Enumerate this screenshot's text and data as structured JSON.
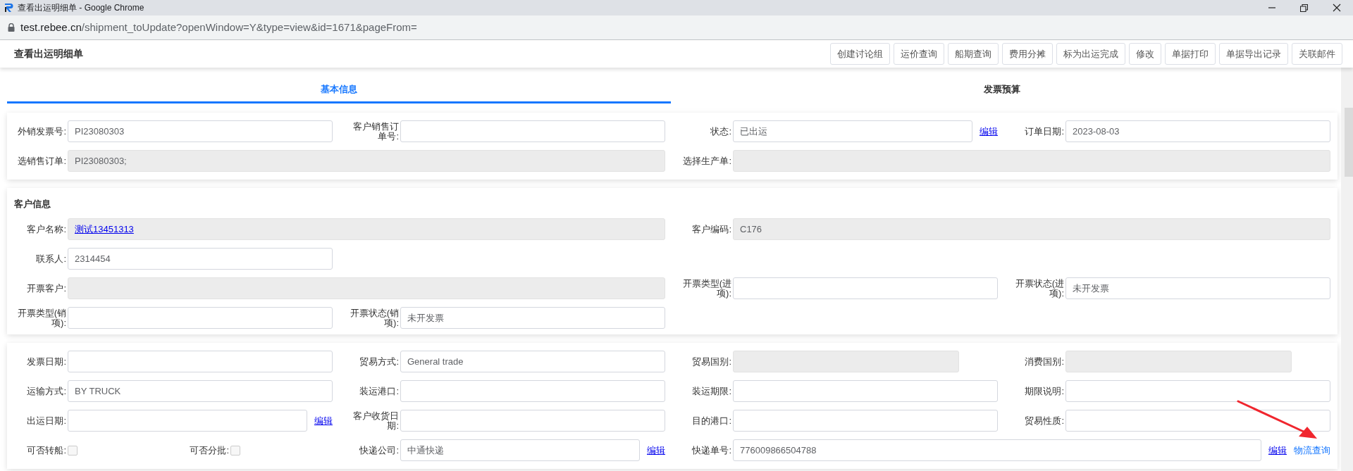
{
  "browser": {
    "title": "查看出运明细单 - Google Chrome",
    "url_host": "test.rebee.cn",
    "url_path": "/shipment_toUpdate?openWindow=Y&type=view&id=1671&pageFrom="
  },
  "header": {
    "title": "查看出运明细单",
    "buttons": [
      "创建讨论组",
      "运价查询",
      "船期查询",
      "费用分摊",
      "标为出运完成",
      "修改",
      "单据打印",
      "单据导出记录",
      "关联邮件"
    ]
  },
  "tabs": [
    {
      "label": "基本信息",
      "selected": true
    },
    {
      "label": "发票预算",
      "selected": false
    }
  ],
  "sections": [
    {
      "rows": [
        [
          {
            "kind": "field",
            "label": "外销发票号:",
            "value": "PI23080303",
            "readonly": false,
            "wide": false
          },
          {
            "kind": "field",
            "label": "客户销售订单号:",
            "readonly": false,
            "wide": false
          },
          {
            "kind": "field",
            "label": "状态:",
            "value": "已出运",
            "readonly": false,
            "wide": false,
            "links": [
              {
                "text": "编辑",
                "underline": true
              }
            ]
          },
          {
            "kind": "field",
            "label": "订单日期:",
            "value": "2023-08-03",
            "readonly": false,
            "wide": false
          }
        ],
        [
          {
            "kind": "field",
            "label": "选销售订单:",
            "value": "PI23080303;",
            "readonly": true,
            "wide": true
          },
          {
            "kind": "field",
            "label": "选择生产单:",
            "readonly": true,
            "wide": true
          }
        ]
      ]
    },
    {
      "title": "客户信息",
      "rows": [
        [
          {
            "kind": "link-field",
            "label": "客户名称:",
            "value": "测试13451313",
            "readonly": true,
            "wide": true
          },
          {
            "kind": "field",
            "label": "客户编码:",
            "value": "C176",
            "readonly": true,
            "wide": true
          }
        ],
        [
          {
            "kind": "field",
            "label": "联系人:",
            "value": "2314454",
            "readonly": false,
            "wide": false
          }
        ],
        [
          {
            "kind": "field",
            "label": "开票客户:",
            "readonly": true,
            "wide": true
          },
          {
            "kind": "field",
            "label": "开票类型(进项):",
            "readonly": false,
            "wide": false
          },
          {
            "kind": "field",
            "label": "开票状态(进项):",
            "value": "未开发票",
            "readonly": false,
            "wide": false
          }
        ],
        [
          {
            "kind": "field",
            "label": "开票类型(销项):",
            "readonly": false,
            "wide": false
          },
          {
            "kind": "field",
            "label": "开票状态(销项):",
            "value": "未开发票",
            "readonly": false,
            "wide": false
          }
        ]
      ]
    },
    {
      "rows": [
        [
          {
            "kind": "field",
            "label": "发票日期:",
            "readonly": false,
            "wide": false
          },
          {
            "kind": "field",
            "label": "贸易方式:",
            "value": "General trade",
            "readonly": false,
            "wide": false
          },
          {
            "kind": "field",
            "label": "贸易国别:",
            "readonly": true,
            "wide": false
          },
          {
            "kind": "field",
            "label": "消费国别:",
            "readonly": true,
            "wide": false
          }
        ],
        [
          {
            "kind": "field",
            "label": "运输方式:",
            "value": "BY TRUCK",
            "readonly": false,
            "wide": false
          },
          {
            "kind": "field",
            "label": "装运港口:",
            "readonly": false,
            "wide": false
          },
          {
            "kind": "field",
            "label": "装运期限:",
            "readonly": false,
            "wide": false
          },
          {
            "kind": "field",
            "label": "期限说明:",
            "readonly": false,
            "wide": false
          }
        ],
        [
          {
            "kind": "field",
            "label": "出运日期:",
            "readonly": false,
            "wide": false,
            "links": [
              {
                "text": "编辑",
                "underline": true
              }
            ]
          },
          {
            "kind": "field",
            "label": "客户收货日期:",
            "readonly": false,
            "wide": false
          },
          {
            "kind": "field",
            "label": "目的港口:",
            "readonly": false,
            "wide": false
          },
          {
            "kind": "field",
            "label": "贸易性质:",
            "readonly": false,
            "wide": false
          }
        ],
        [
          {
            "kind": "checks",
            "checks": [
              {
                "label": "可否转船:",
                "checked": false
              },
              {
                "label": "可否分批:",
                "checked": false
              }
            ]
          },
          {
            "kind": "field",
            "label": "快递公司:",
            "value": "中通快递",
            "readonly": false,
            "wide": false,
            "links": [
              {
                "text": "编辑",
                "underline": true
              }
            ]
          },
          {
            "kind": "field",
            "label": "快递单号:",
            "value": "776009866504788",
            "readonly": false,
            "wide": true,
            "links": [
              {
                "text": "编辑",
                "underline": true
              },
              {
                "text": "物流查询",
                "underline": false
              }
            ]
          }
        ]
      ]
    }
  ],
  "annotation": {
    "kind": "arrow"
  }
}
